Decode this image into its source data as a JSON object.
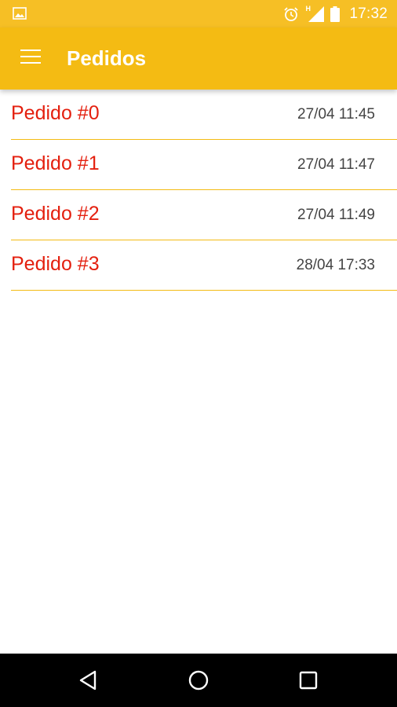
{
  "status_bar": {
    "time": "17:32",
    "network_indicator": "H",
    "icons": [
      "image-notification-icon",
      "alarm-icon",
      "signal-icon",
      "battery-icon"
    ]
  },
  "app_bar": {
    "title": "Pedidos",
    "menu_icon": "hamburger-menu-icon"
  },
  "orders": [
    {
      "title": "Pedido #0",
      "time": "27/04 11:45"
    },
    {
      "title": "Pedido #1",
      "time": "27/04 11:47"
    },
    {
      "title": "Pedido #2",
      "time": "27/04 11:49"
    },
    {
      "title": "Pedido #3",
      "time": "28/04 17:33"
    }
  ],
  "nav_bar": {
    "icons": [
      "back-icon",
      "home-icon",
      "recents-icon"
    ]
  },
  "colors": {
    "status_bar": "#F6BF25",
    "app_bar": "#F4BB13",
    "item_title": "#E4200F",
    "item_time": "#444444",
    "divider": "#F4BB13",
    "nav_bar": "#000000"
  }
}
